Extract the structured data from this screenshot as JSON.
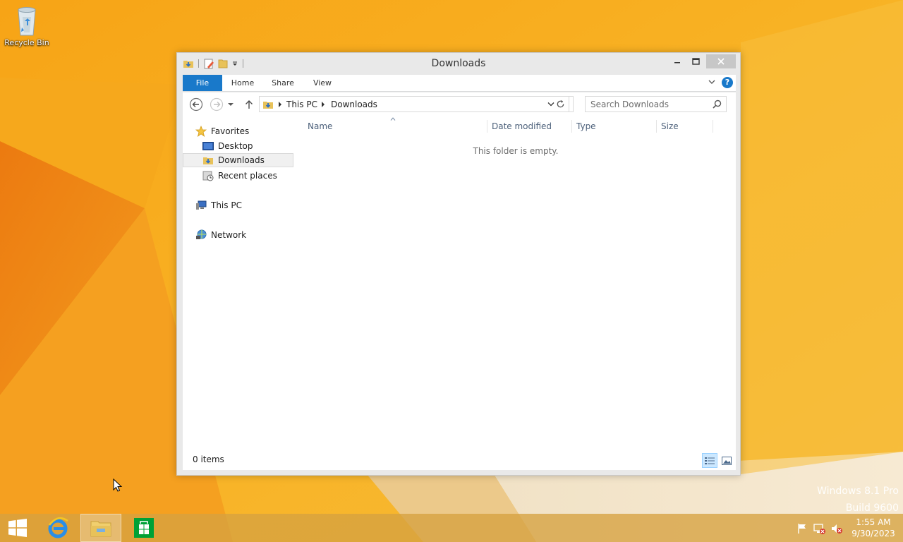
{
  "desktop": {
    "recycle_bin_label": "Recycle Bin",
    "watermark_line1": "Windows 8.1 Pro",
    "watermark_line2": "Build 9600"
  },
  "window": {
    "title": "Downloads",
    "tabs": {
      "file": "File",
      "home": "Home",
      "share": "Share",
      "view": "View"
    },
    "address": {
      "crumbs": [
        "This PC",
        "Downloads"
      ]
    },
    "search_placeholder": "Search Downloads",
    "nav_pane": {
      "favorites": "Favorites",
      "desktop": "Desktop",
      "downloads": "Downloads",
      "recent_places": "Recent places",
      "this_pc": "This PC",
      "network": "Network"
    },
    "columns": {
      "name": "Name",
      "date_modified": "Date modified",
      "type": "Type",
      "size": "Size"
    },
    "empty_message": "This folder is empty.",
    "status": "0 items"
  },
  "taskbar": {
    "time": "1:55 AM",
    "date": "9/30/2023"
  },
  "colors": {
    "accent": "#1979ca",
    "wallpaper": "#f4a51c"
  }
}
